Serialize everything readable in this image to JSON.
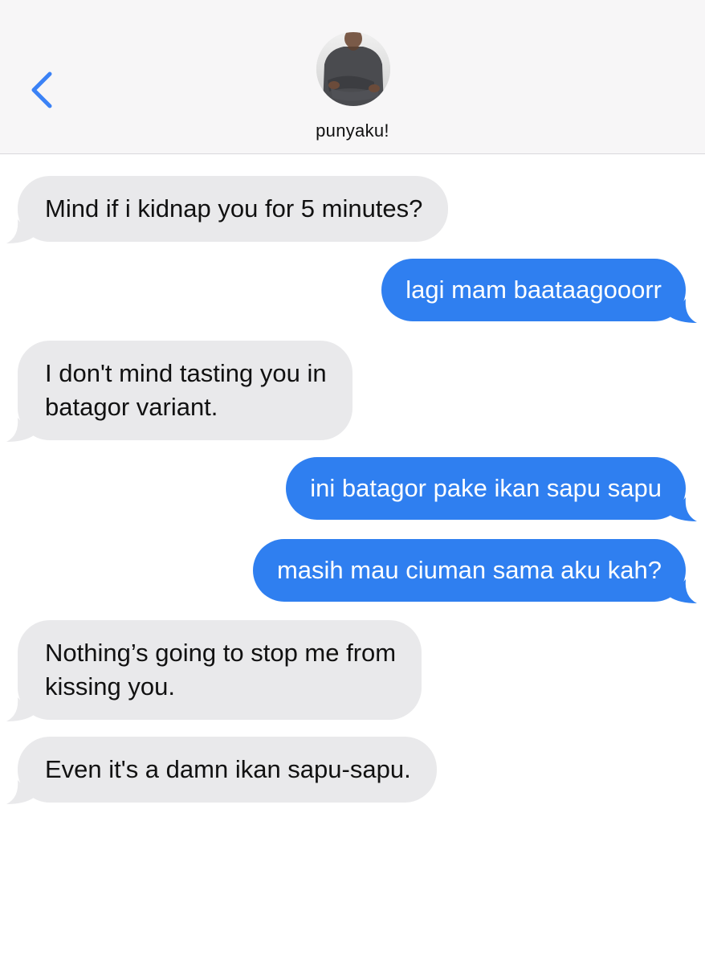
{
  "header": {
    "contact_name": "punyaku!",
    "back_icon": "chevron-left-icon",
    "accent_color": "#3b82f6"
  },
  "colors": {
    "incoming_bubble": "#e9e9eb",
    "outgoing_bubble": "#2f7ff0",
    "header_bg": "#f7f6f7"
  },
  "messages": [
    {
      "direction": "incoming",
      "text": "Mind if i kidnap you for 5 minutes?"
    },
    {
      "direction": "outgoing",
      "text": "lagi mam baataagooorr"
    },
    {
      "direction": "incoming",
      "lines": [
        "I don't mind tasting you in",
        "batagor variant."
      ]
    },
    {
      "direction": "outgoing",
      "text": "ini batagor pake ikan sapu sapu"
    },
    {
      "direction": "outgoing",
      "text": "masih mau ciuman sama aku kah?"
    },
    {
      "direction": "incoming",
      "lines": [
        "Nothing’s going to stop me from",
        "kissing you."
      ]
    },
    {
      "direction": "incoming",
      "text": "Even it's a damn ikan sapu-sapu."
    }
  ]
}
